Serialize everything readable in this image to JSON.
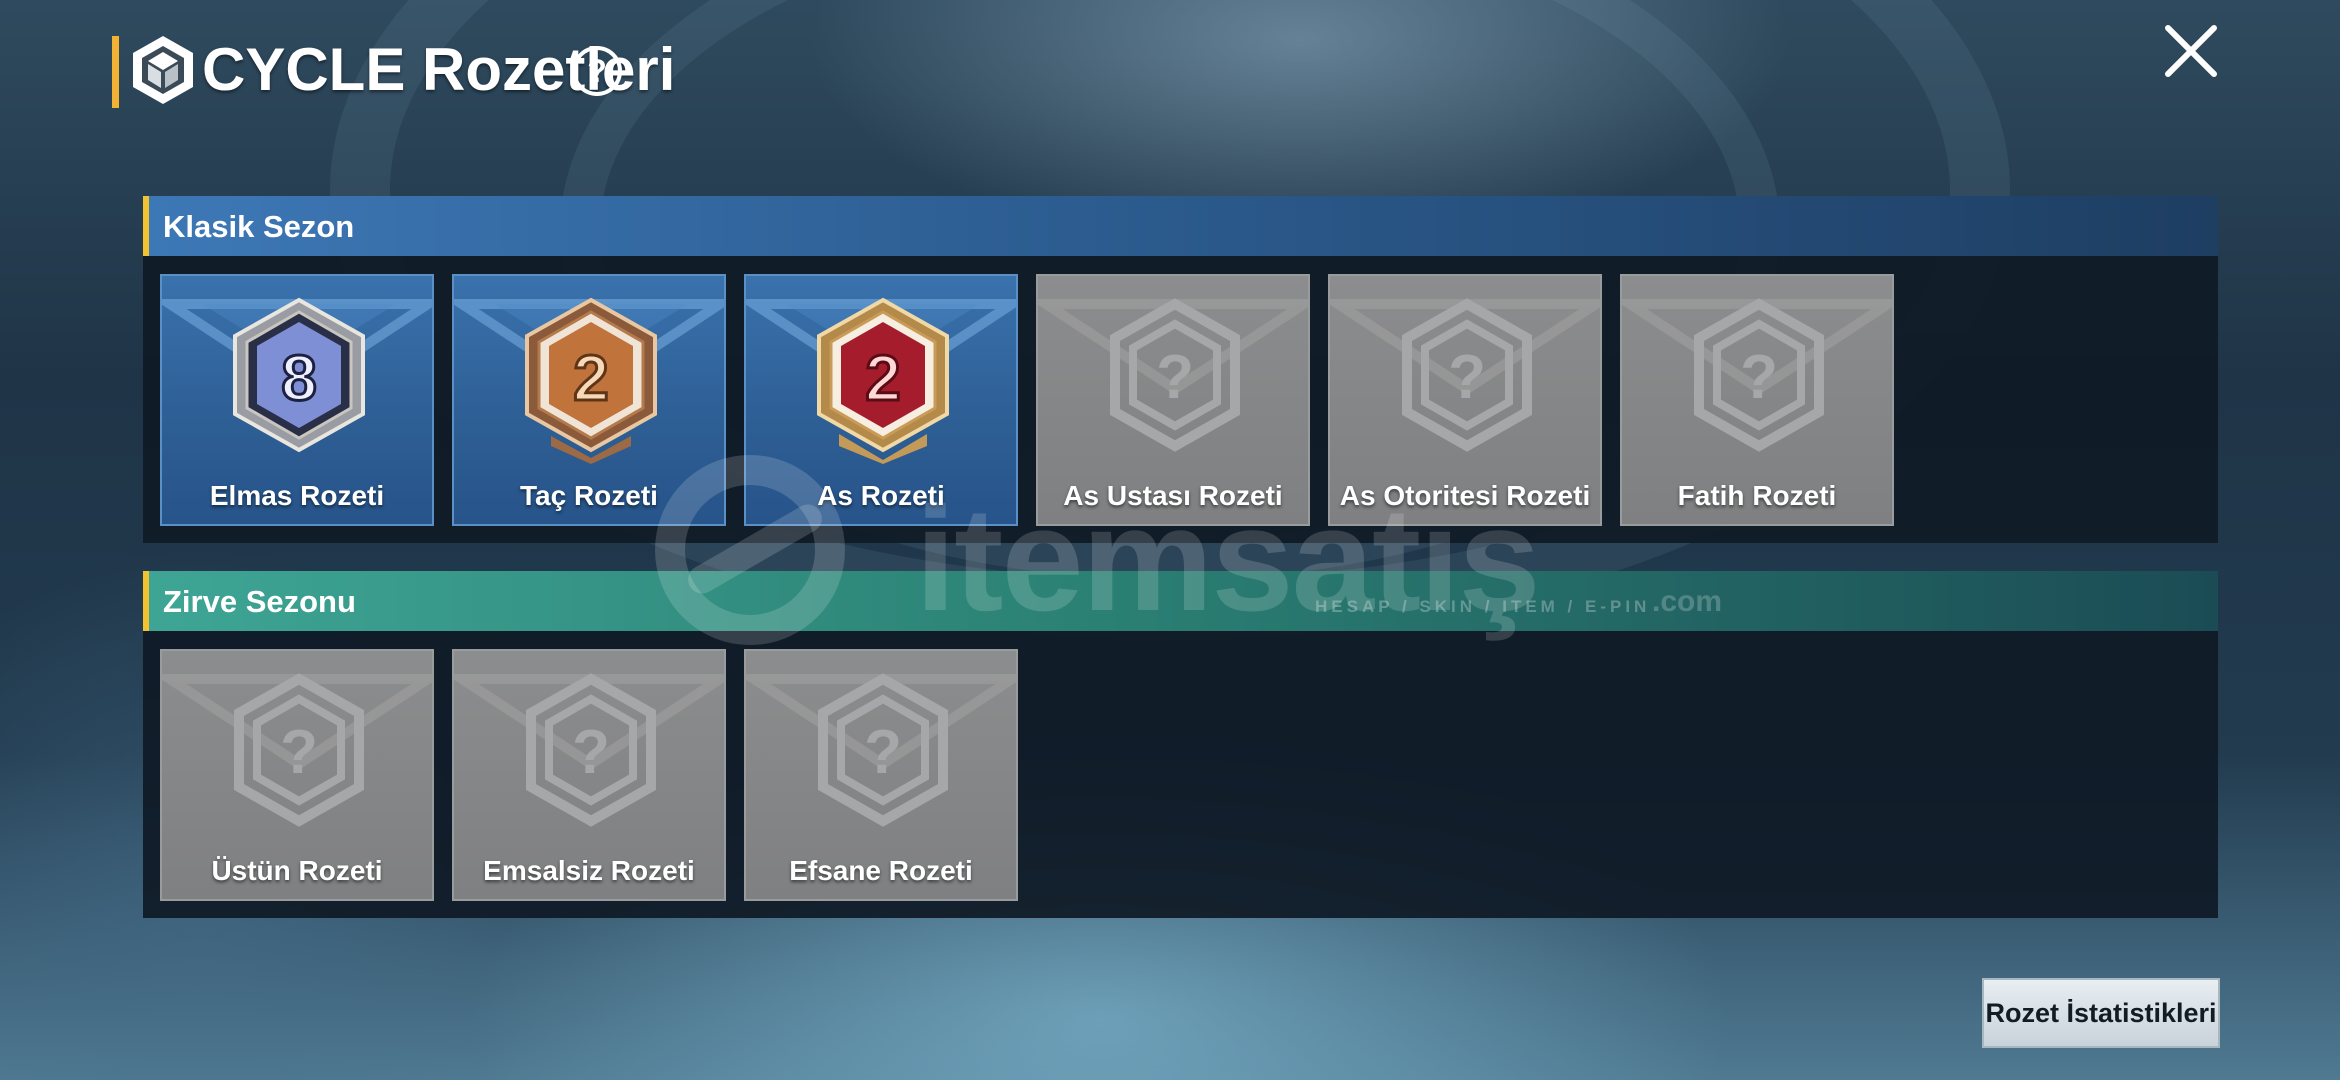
{
  "header": {
    "title": "CYCLE Rozetleri"
  },
  "classic_season": {
    "title": "Klasik Sezon",
    "badges": [
      {
        "label": "Elmas Rozeti",
        "state": "unlocked",
        "number": "8",
        "tier_color": "#7f8fd6"
      },
      {
        "label": "Taç Rozeti",
        "state": "unlocked",
        "number": "2",
        "tier_color": "#c1733c"
      },
      {
        "label": "As Rozeti",
        "state": "unlocked",
        "number": "2",
        "tier_color": "#a51d2c"
      },
      {
        "label": "As Ustası Rozeti",
        "state": "locked"
      },
      {
        "label": "As Otoritesi Rozeti",
        "state": "locked"
      },
      {
        "label": "Fatih Rozeti",
        "state": "locked"
      }
    ]
  },
  "summit_season": {
    "title": "Zirve Sezonu",
    "badges": [
      {
        "label": "Üstün Rozeti",
        "state": "locked"
      },
      {
        "label": "Emsalsiz Rozeti",
        "state": "locked"
      },
      {
        "label": "Efsane Rozeti",
        "state": "locked"
      }
    ]
  },
  "watermark": {
    "text": "itemsatış",
    "tagline": "HESAP / SKIN / ITEM / E-PIN",
    "suffix": ".com"
  },
  "footer": {
    "stats_button": "Rozet İstatistikleri"
  },
  "colors": {
    "accent": "#f2b233",
    "classic_header": "#3d78b6",
    "summit_header": "#3ea595"
  },
  "icons": {
    "title_logo": "hexagon-cube-icon",
    "help": "question-circle-icon",
    "close": "close-icon",
    "locked_badge": "locked-question-hexagon-icon"
  }
}
